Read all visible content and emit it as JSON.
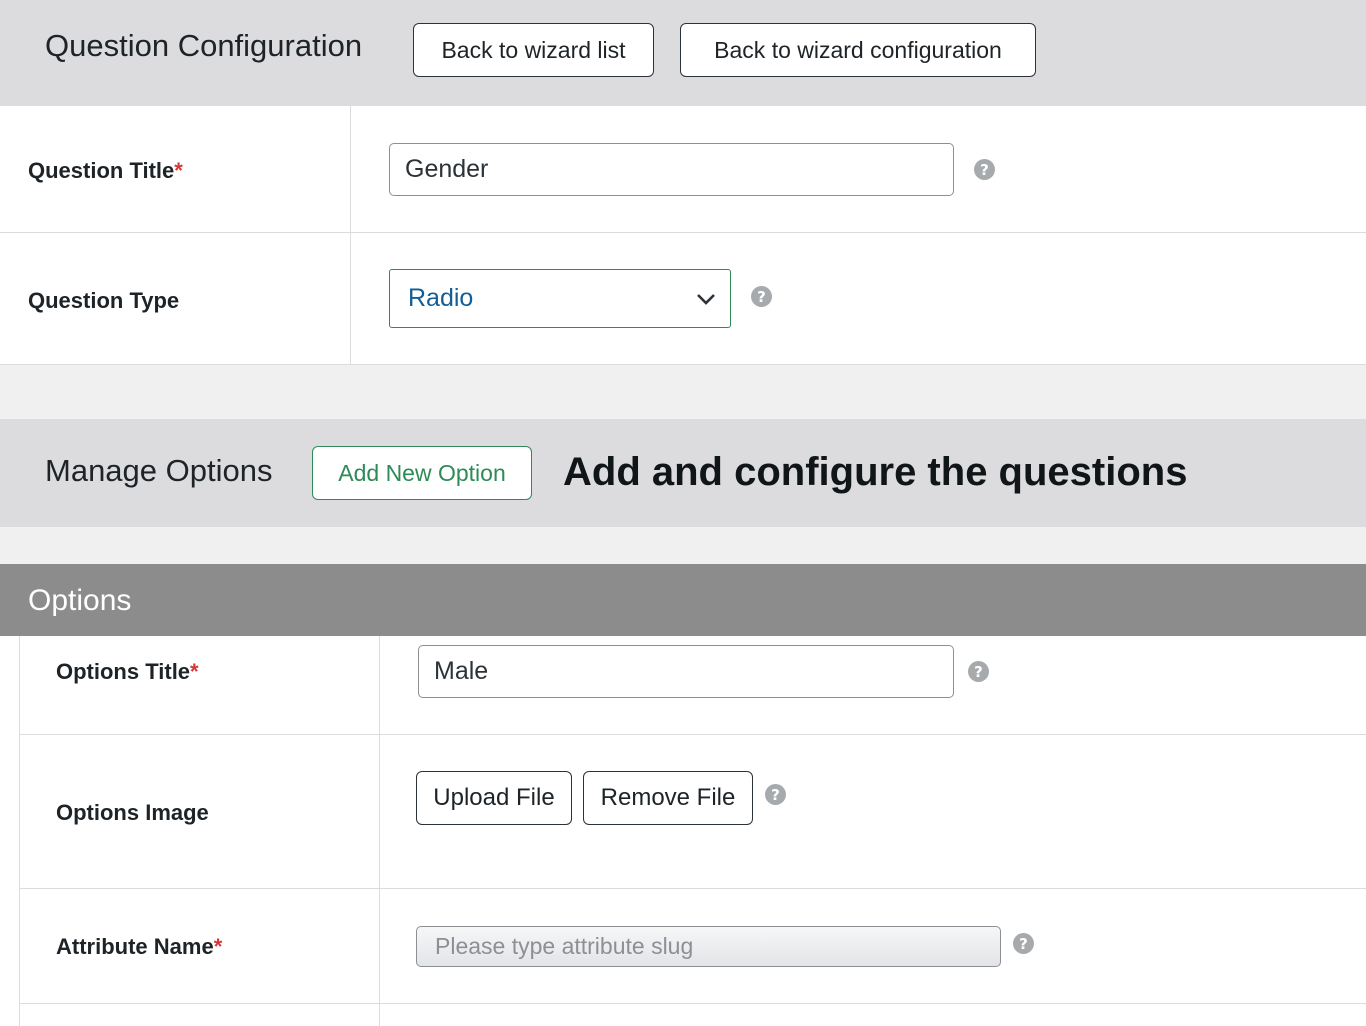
{
  "header": {
    "title": "Question Configuration",
    "back_list_label": "Back to wizard list",
    "back_config_label": "Back to wizard configuration"
  },
  "question": {
    "title_label": "Question Title",
    "title_required": "*",
    "title_value": "Gender",
    "type_label": "Question Type",
    "type_value": "Radio"
  },
  "manage": {
    "title": "Manage Options",
    "add_label": "Add New Option",
    "caption": "Add and configure the questions",
    "add_color": "#2e8b57"
  },
  "options": {
    "section_title": "Options",
    "title_label": "Options Title",
    "title_required": "*",
    "title_value": "Male",
    "image_label": "Options Image",
    "upload_label": "Upload File",
    "remove_label": "Remove File",
    "attr_label": "Attribute Name",
    "attr_required": "*",
    "attr_placeholder": "Please type attribute slug"
  },
  "icons": {
    "help": "?",
    "help_icon_name": "question-circle-icon",
    "chevron_icon_name": "chevron-down-icon"
  }
}
